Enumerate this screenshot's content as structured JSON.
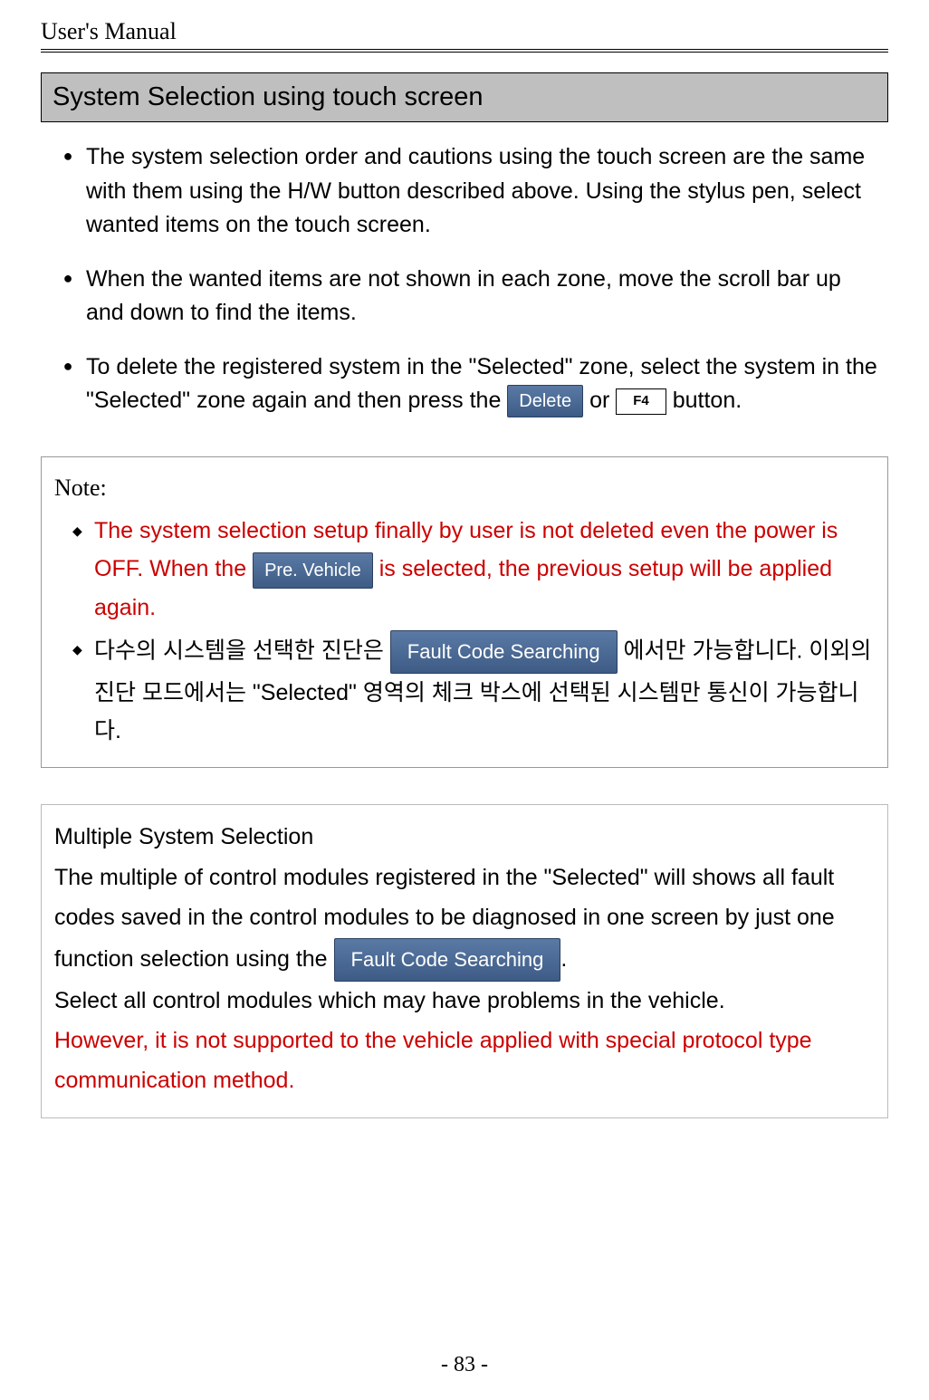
{
  "header": {
    "title": "User's Manual"
  },
  "section": {
    "title": "System Selection using touch screen"
  },
  "bullets": [
    {
      "text": "The system selection order and cautions using the touch screen are the same with them using the H/W button described above. Using the stylus pen, select wanted items on the touch screen."
    },
    {
      "text": "When the wanted items are not shown in each zone, move the scroll bar up and down to find the items."
    }
  ],
  "bullet3": {
    "part1": "To delete the registered system in the \"Selected\" zone, select the system in the \"Selected\" zone again and then press the ",
    "btn_delete": "Delete",
    "part2": " or ",
    "btn_f4": "F4",
    "part3": " button."
  },
  "note": {
    "label": "Note:",
    "item1": {
      "part1": "The system selection setup finally by user is not deleted even the power is OFF. When the ",
      "btn": "Pre. Vehicle",
      "part2": " is selected, the previous setup will be applied again."
    },
    "item2": {
      "part1": "다수의  시스템을  선택한  진단은  ",
      "btn": "Fault Code Searching",
      "part2": "  에서만  가능합니다.  이외의  진단  모드에서는  \"Selected\"  영역의  체크  박스에  선택된  시스템만  통신이  가능합니다."
    }
  },
  "multi": {
    "title": "Multiple System Selection",
    "part1": "  The multiple of control modules registered in the \"Selected\" will shows all fault codes saved in the control modules to be diagnosed in one screen by just one function selection using the ",
    "btn": "Fault Code Searching",
    "part2": ".",
    "line2": "  Select all control modules which may have problems in the vehicle.",
    "red": "However, it is not supported to the vehicle applied with special protocol type communication method."
  },
  "page": "- 83 -"
}
